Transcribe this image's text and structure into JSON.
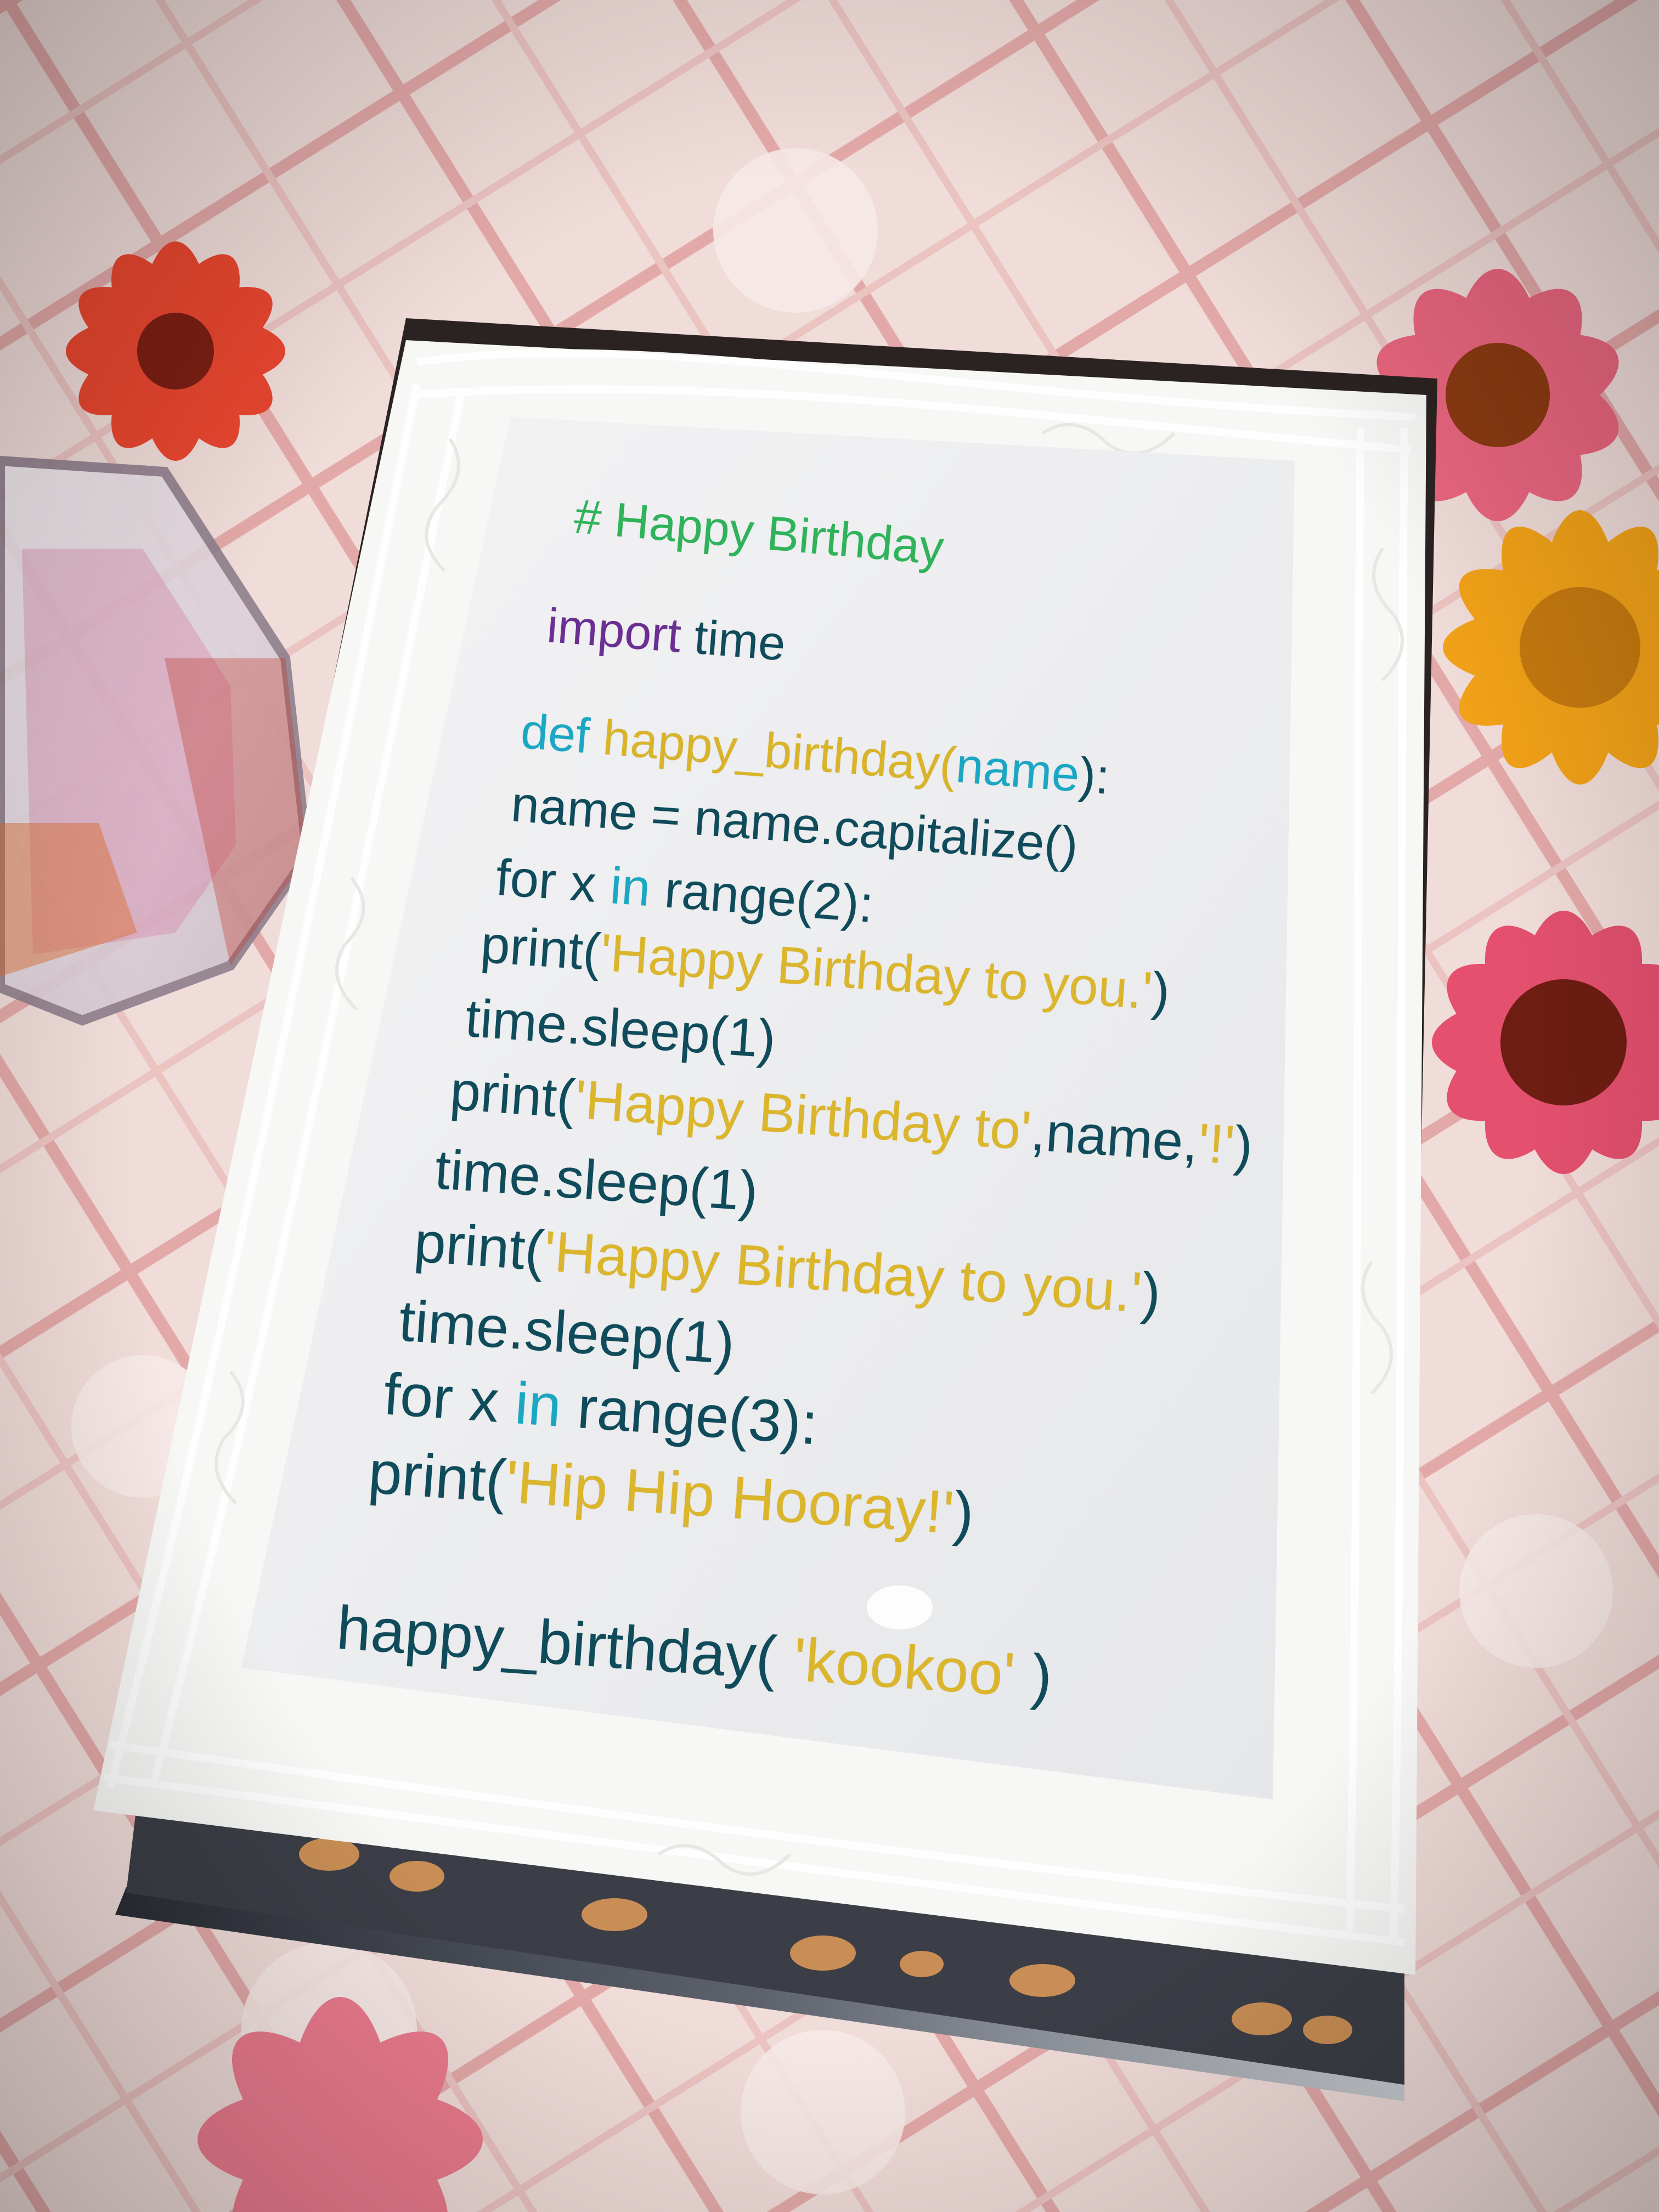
{
  "code": {
    "comment": "# Happy Birthday",
    "import_kw": "import",
    "import_mod": " time",
    "def_kw": "def",
    "def_fn": " happy_birthday",
    "def_open": "(",
    "def_param": "name",
    "def_close": "):",
    "line_name": "name = name.capitalize()",
    "for1_a": "for x ",
    "for1_in": "in",
    "for1_b": " range(2):",
    "p1_a": "print(",
    "p1_s": "'Happy Birthday to you.'",
    "p1_b": ")",
    "sleep": "time.sleep(1)",
    "p2_a": "print(",
    "p2_s": "'Happy Birthday to'",
    "p2_b": ",name,",
    "p2_s2": "'!'",
    "p2_c": ")",
    "p3_a": "print(",
    "p3_s": "'Happy Birthday to you.'",
    "p3_b": ")",
    "for2_a": "for x ",
    "for2_in": "in",
    "for2_b": " range(3):",
    "p4_a": "print(",
    "p4_s": "'Hip Hip Hooray!'",
    "p4_b": ")",
    "call_a": "happy_birthday( ",
    "call_s": "'kookoo'",
    "call_b": " )"
  }
}
